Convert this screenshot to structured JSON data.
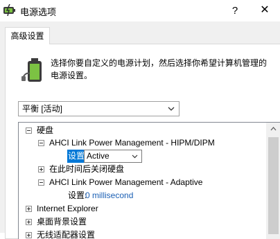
{
  "window": {
    "title": "电源选项",
    "help_label": "?",
    "close_label": "✕"
  },
  "tabs": [
    {
      "label": "高级设置"
    }
  ],
  "intro_text": "选择你要自定义的电源计划，然后选择你希望计算机管理的电源设置。",
  "plan_select": {
    "value": "平衡 [活动]"
  },
  "tree": {
    "items": [
      {
        "label": "硬盘",
        "expanded": true
      },
      {
        "label": "AHCI Link Power Management - HIPM/DIPM",
        "expanded": true
      },
      {
        "setting_label": "设置:",
        "value": "Active"
      },
      {
        "label": "在此时间后关闭硬盘",
        "expanded": false
      },
      {
        "label": "AHCI Link Power Management - Adaptive",
        "expanded": true
      },
      {
        "setting_label": "设置:",
        "value": "0 millisecond"
      },
      {
        "label": "Internet Explorer",
        "expanded": false
      },
      {
        "label": "桌面背景设置",
        "expanded": false
      },
      {
        "label": "无线适配器设置",
        "expanded": false
      }
    ]
  },
  "colors": {
    "selection": "#0078d7",
    "value_link": "#1a5fb4"
  }
}
